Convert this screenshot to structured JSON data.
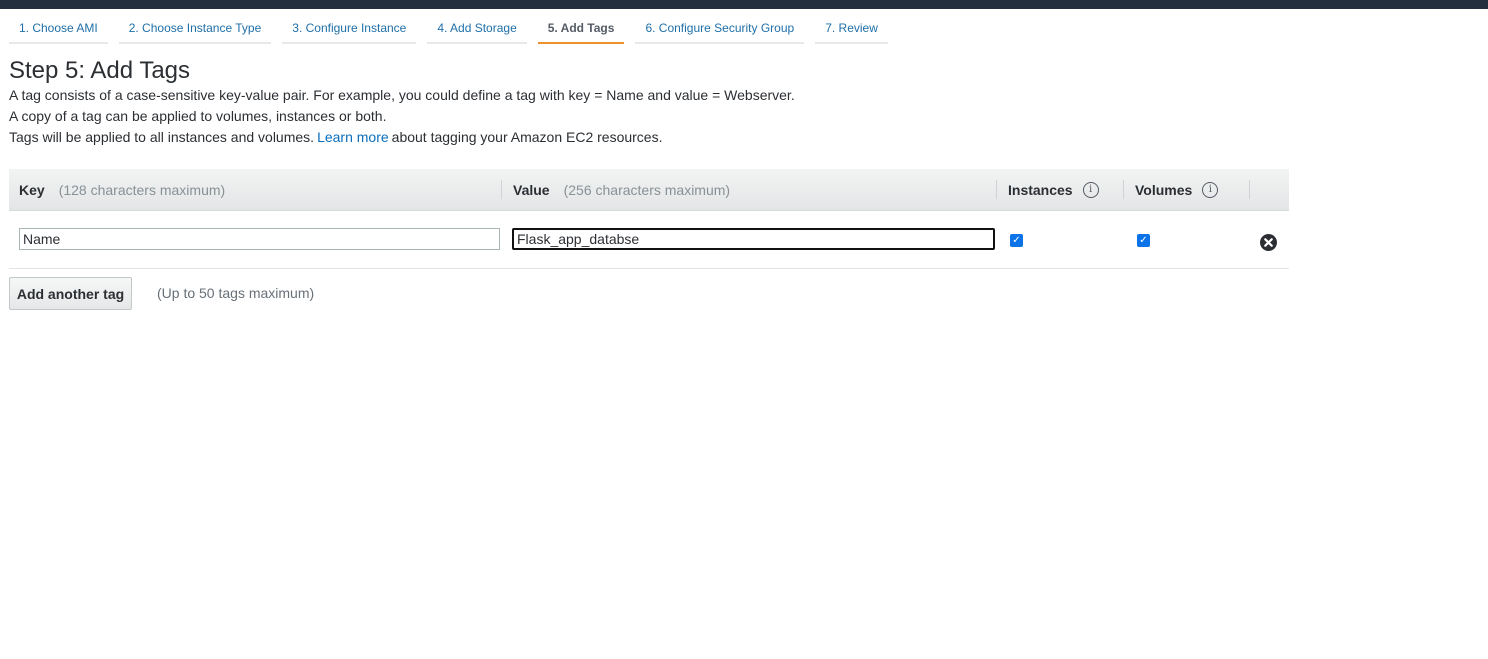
{
  "wizard": {
    "steps": [
      {
        "label": "1. Choose AMI"
      },
      {
        "label": "2. Choose Instance Type"
      },
      {
        "label": "3. Configure Instance"
      },
      {
        "label": "4. Add Storage"
      },
      {
        "label": "5. Add Tags"
      },
      {
        "label": "6. Configure Security Group"
      },
      {
        "label": "7. Review"
      }
    ],
    "active_step": "5. Add Tags"
  },
  "page": {
    "title": "Step 5: Add Tags",
    "desc_line1": "A tag consists of a case-sensitive key-value pair. For example, you could define a tag with key = Name and value = Webserver.",
    "desc_line2": "A copy of a tag can be applied to volumes, instances or both.",
    "desc_line3_before": "Tags will be applied to all instances and volumes.",
    "learn_more_link": "Learn more",
    "desc_line3_after": "about tagging your Amazon EC2 resources."
  },
  "table": {
    "headers": {
      "key": "Key",
      "key_hint": "(128 characters maximum)",
      "value": "Value",
      "value_hint": "(256 characters maximum)",
      "instances": "Instances",
      "volumes": "Volumes"
    },
    "rows": [
      {
        "key": "Name",
        "value": "Flask_app_databse",
        "instances": true,
        "volumes": true
      }
    ]
  },
  "footer": {
    "add_button": "Add another tag",
    "max_note": "(Up to 50 tags maximum)"
  },
  "colors": {
    "topbar": "#232f3e",
    "link": "#0a6ebd",
    "active_tab_underline": "#ec912e",
    "checkbox": "#0b72e7"
  },
  "icons": {
    "info": "info-icon",
    "remove": "close-circle-icon",
    "check": "check-icon"
  }
}
